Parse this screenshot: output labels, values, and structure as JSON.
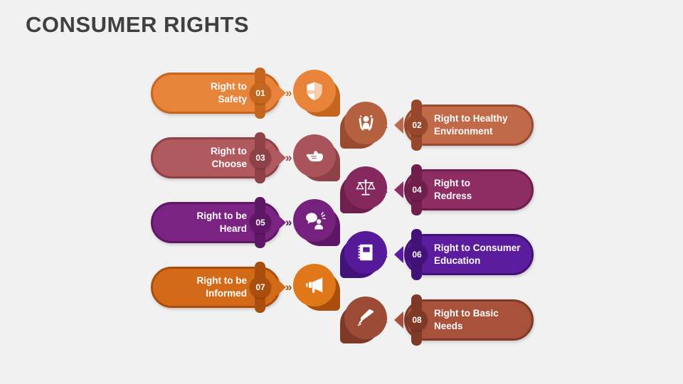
{
  "slide": {
    "title": "CONSUMER RIGHTS",
    "background_color": "#f1f1f1",
    "title_color": "#404040"
  },
  "arrows": {
    "right": "»",
    "left": "«"
  },
  "items": [
    {
      "number": "01",
      "label": "Right to\nSafety",
      "side": "left",
      "icon": "shield-icon",
      "pill_color": "#E8833A",
      "border_color": "#C4661D",
      "band_color": "#C4661D",
      "badge_color": "#C4661D",
      "disc_color": "#E8833A",
      "disc_back_color": "#C4661D",
      "arrow_color": "#D0701F"
    },
    {
      "number": "02",
      "label": "Right to Healthy\nEnvironment",
      "side": "right",
      "icon": "hands-holding-person-icon",
      "pill_color": "#C06A4A",
      "border_color": "#9A4A2E",
      "band_color": "#96472C",
      "badge_color": "#96472C",
      "disc_color": "#B5603F",
      "disc_back_color": "#9A4A2E",
      "arrow_color": "#9A4A2E"
    },
    {
      "number": "03",
      "label": "Right to\nChoose",
      "side": "left",
      "icon": "pointing-hand-icon",
      "pill_color": "#B0595E",
      "border_color": "#8E4147",
      "band_color": "#8E4147",
      "badge_color": "#8E4147",
      "disc_color": "#A8545A",
      "disc_back_color": "#8E4147",
      "arrow_color": "#8E4147"
    },
    {
      "number": "04",
      "label": "Right to\nRedress",
      "side": "right",
      "icon": "balance-scale-icon",
      "pill_color": "#8E2C64",
      "border_color": "#6E1F4C",
      "band_color": "#6E1F4C",
      "badge_color": "#6E1F4C",
      "disc_color": "#85285D",
      "disc_back_color": "#6E1F4C",
      "arrow_color": "#6E1F4C"
    },
    {
      "number": "05",
      "label": "Right to be\nHeard",
      "side": "left",
      "icon": "speech-bubble-person-icon",
      "pill_color": "#7B2382",
      "border_color": "#5D1764",
      "band_color": "#5D1764",
      "badge_color": "#5D1764",
      "disc_color": "#76217D",
      "disc_back_color": "#5D1764",
      "arrow_color": "#5D1764"
    },
    {
      "number": "06",
      "label": "Right to Consumer\nEducation",
      "side": "right",
      "icon": "notebook-icon",
      "pill_color": "#5B1D9E",
      "border_color": "#431279",
      "band_color": "#431279",
      "badge_color": "#431279",
      "disc_color": "#55199A",
      "disc_back_color": "#431279",
      "arrow_color": "#431279"
    },
    {
      "number": "07",
      "label": "Right to be\nInformed",
      "side": "left",
      "icon": "megaphone-icon",
      "pill_color": "#D26A18",
      "border_color": "#A94E0D",
      "band_color": "#A94E0D",
      "badge_color": "#A94E0D",
      "disc_color": "#E07718",
      "disc_back_color": "#A94E0D",
      "arrow_color": "#A94E0D"
    },
    {
      "number": "08",
      "label": "Right to Basic\nNeeds",
      "side": "right",
      "icon": "pen-nib-icon",
      "pill_color": "#A8523C",
      "border_color": "#7F3A27",
      "band_color": "#7F3A27",
      "badge_color": "#7F3A27",
      "disc_color": "#9B4B36",
      "disc_back_color": "#7F3A27",
      "arrow_color": "#7F3A27"
    }
  ]
}
